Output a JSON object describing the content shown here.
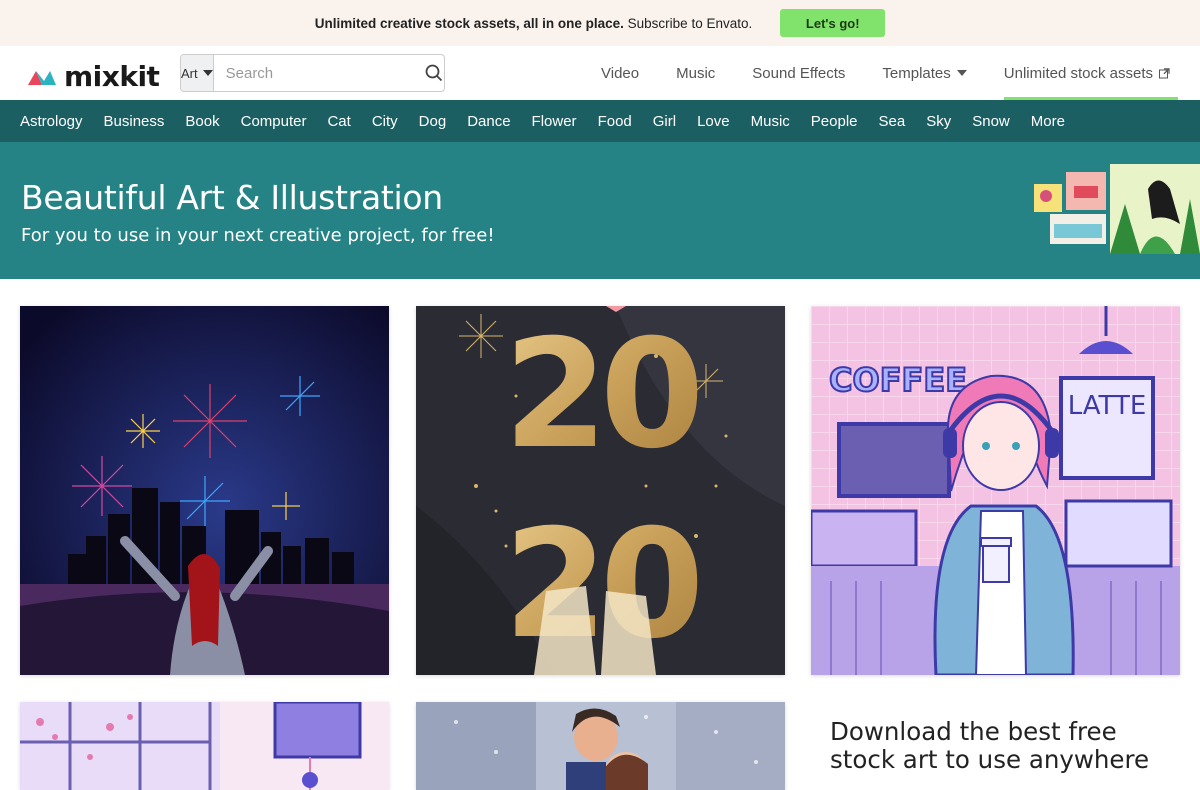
{
  "promo": {
    "text_bold": "Unlimited creative stock assets, all in one place.",
    "text": "Subscribe to Envato.",
    "button": "Let's go!"
  },
  "header": {
    "logo": "mixkit",
    "search_category": "Art",
    "search_placeholder": "Search",
    "nav": [
      "Video",
      "Music",
      "Sound Effects",
      "Templates",
      "Unlimited stock assets"
    ]
  },
  "categories": [
    "Astrology",
    "Business",
    "Book",
    "Computer",
    "Cat",
    "City",
    "Dog",
    "Dance",
    "Flower",
    "Food",
    "Girl",
    "Love",
    "Music",
    "People",
    "Sea",
    "Sky",
    "Snow",
    "More"
  ],
  "hero": {
    "title": "Beautiful Art & Illustration",
    "subtitle": "For you to use in your next creative project, for free!"
  },
  "cards": [
    {
      "alt": "fireworks-city-illustration"
    },
    {
      "alt": "2020-new-year-illustration",
      "text": "2020"
    },
    {
      "alt": "coffee-shop-girl-illustration",
      "sign1": "COFFEE",
      "sign2": "LATTE"
    }
  ],
  "tagline": "Download the best free stock art to use anywhere",
  "colors": {
    "promo_bg": "#faf2ec",
    "accent_green": "#82e36c",
    "category_bar": "#1c5f62",
    "hero_bg": "#268385"
  }
}
